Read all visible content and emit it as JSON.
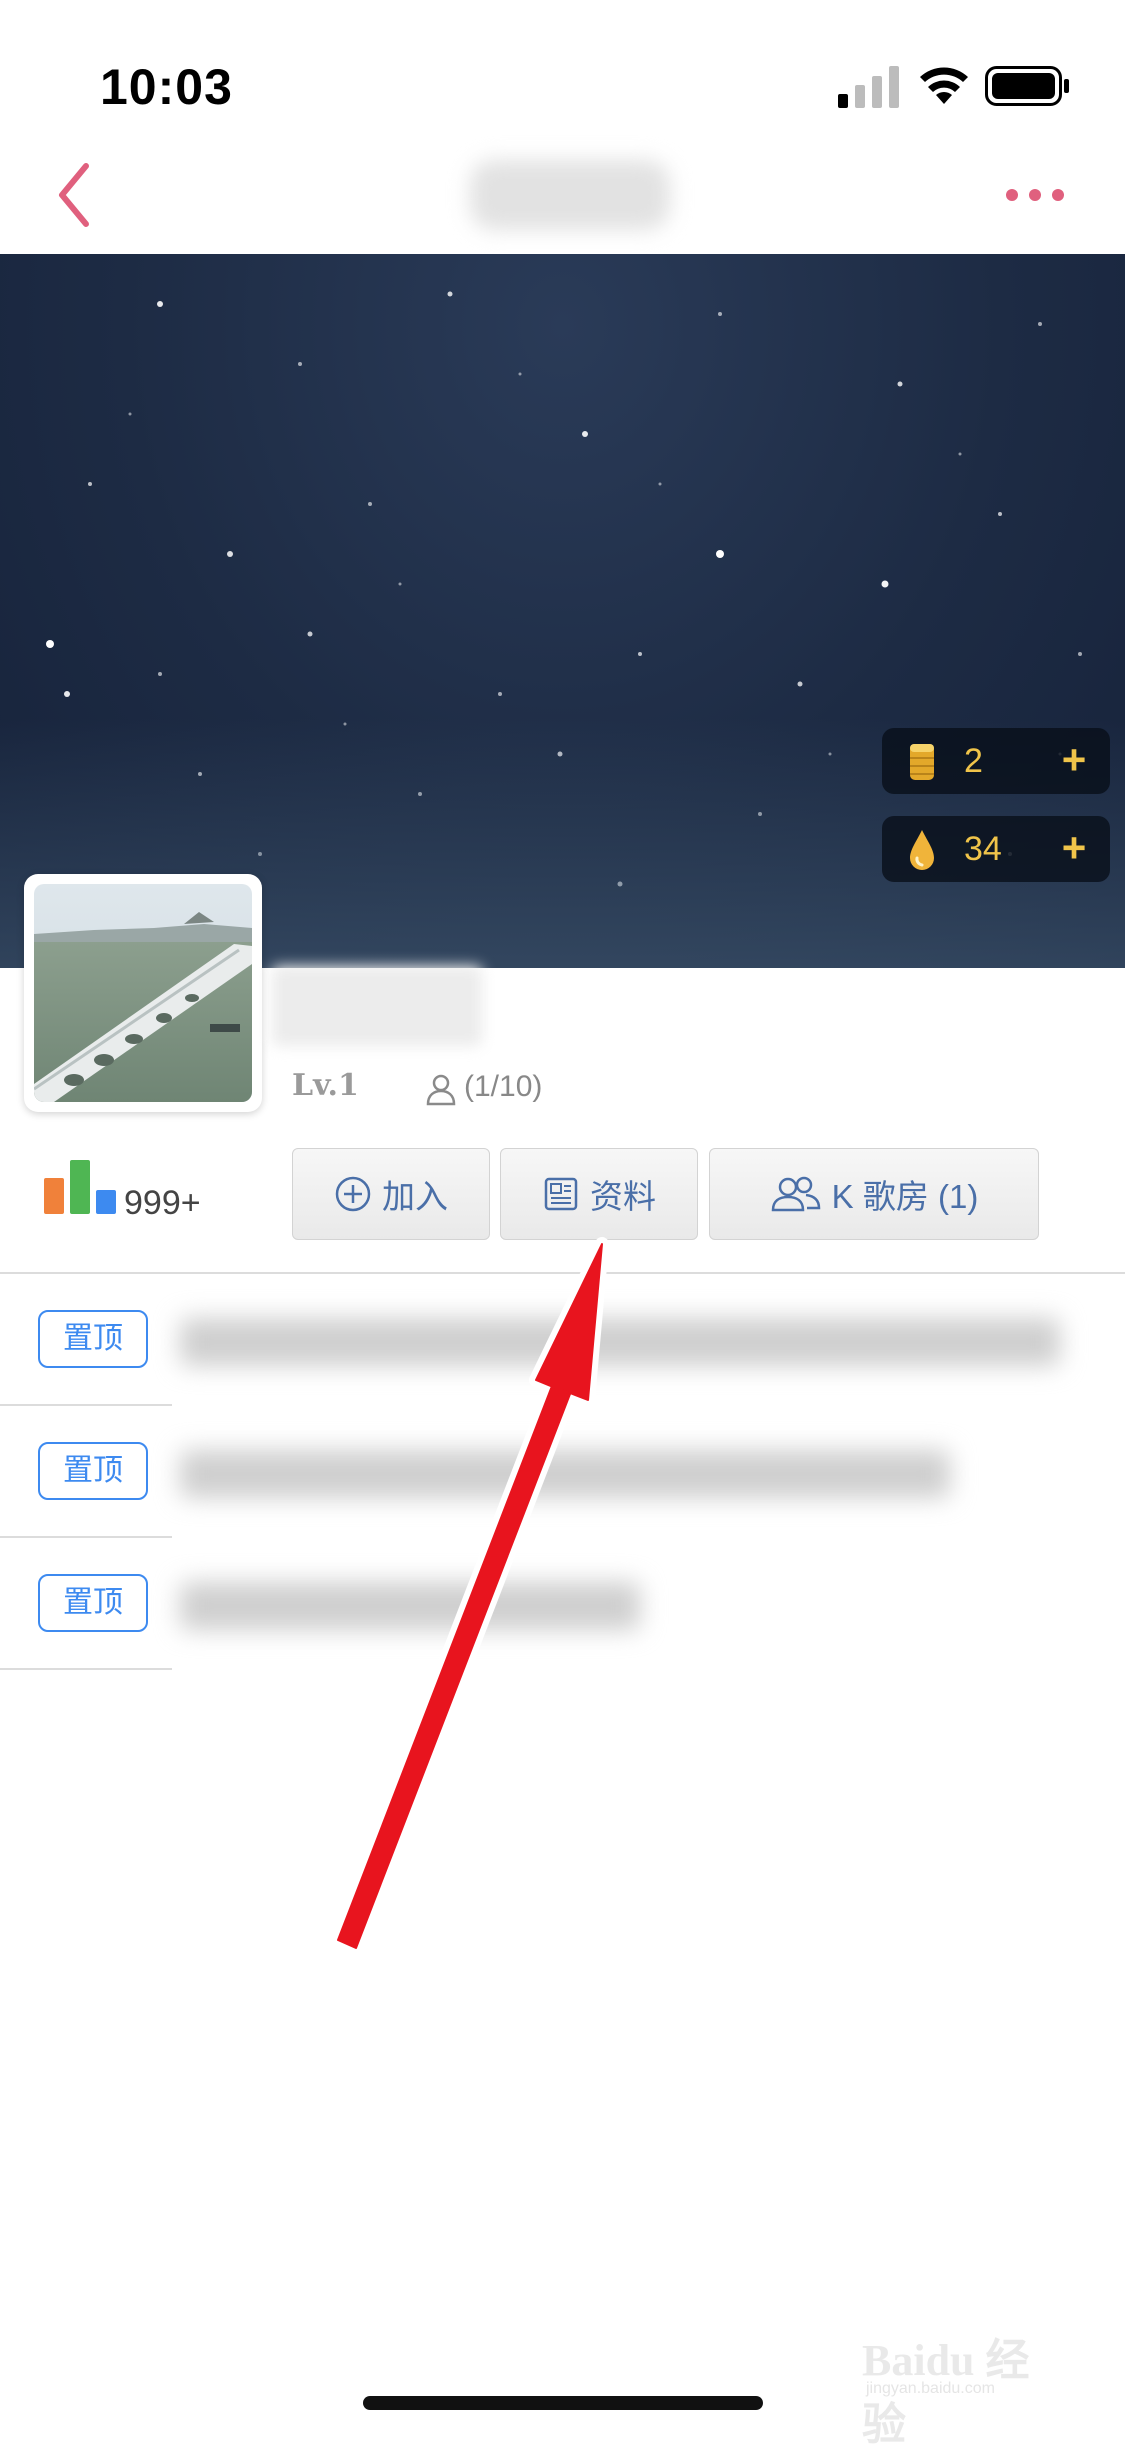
{
  "status_bar": {
    "time": "10:03"
  },
  "wallet": {
    "coin_count": "2",
    "drop_count": "34",
    "plus": "+"
  },
  "group": {
    "level": "Lv.1",
    "member_count": "(1/10)",
    "rank_count": "999+"
  },
  "actions": {
    "join_label": "加入",
    "info_label": "资料",
    "ktv_label": "K 歌房 (1)"
  },
  "pinned": [
    {
      "tag": "置顶"
    },
    {
      "tag": "置顶"
    },
    {
      "tag": "置顶"
    }
  ],
  "watermark": {
    "logo": "Baidu 经验",
    "url": "jingyan.baidu.com"
  },
  "colors": {
    "back_arrow": "#e0607e",
    "accent_blue": "#3d8af0",
    "gold": "#f0c44a",
    "annotation_arrow": "#e8141e"
  }
}
